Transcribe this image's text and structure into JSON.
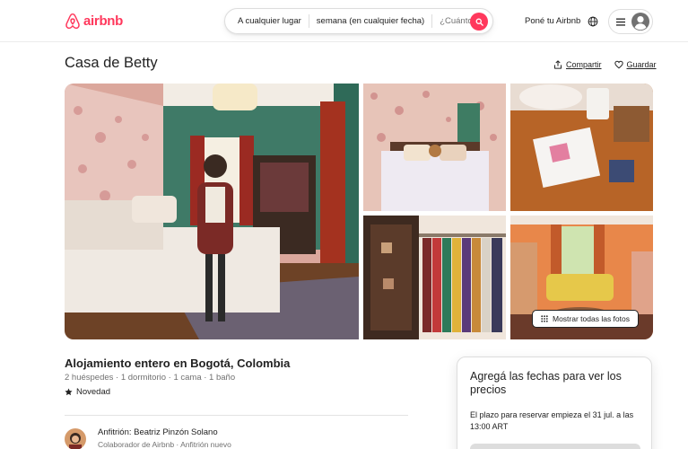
{
  "header": {
    "logo_text": "airbnb",
    "search": {
      "location": "A cualquier lugar",
      "dates": "semana (en cualquier fecha)",
      "guests": "¿Cuántos?"
    },
    "host_link": "Poné tu Airbnb"
  },
  "listing": {
    "title": "Casa de Betty",
    "share_label": "Compartir",
    "save_label": "Guardar",
    "show_all_photos_label": "Mostrar todas las fotos",
    "type": "Alojamiento entero en Bogotá, Colombia",
    "capacity": "2 huéspedes · 1 dormitorio · 1 cama · 1 baño",
    "badge": "Novedad",
    "host_name": "Anfitrión: Beatriz Pinzón Solano",
    "host_subtitle": "Colaborador de Airbnb · Anfitrión nuevo"
  },
  "booking_card": {
    "title": "Agregá las fechas para ver los precios",
    "notice": "El plazo para reservar empieza el 31 jul. a las 13:00 ART"
  },
  "colors": {
    "brand": "#ff385c",
    "text": "#222222",
    "muted": "#717171"
  },
  "icons": {
    "logo": "airbnb-logo-icon",
    "search": "search-icon",
    "globe": "globe-icon",
    "menu": "hamburger-menu-icon",
    "avatar": "user-avatar-icon",
    "share": "share-icon",
    "save": "heart-icon",
    "grid": "grid-dots-icon",
    "badge": "star-icon"
  }
}
